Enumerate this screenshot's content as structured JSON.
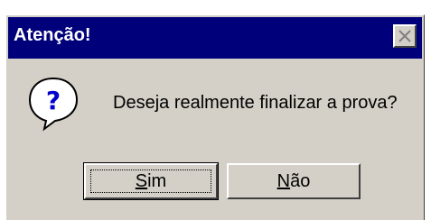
{
  "dialog": {
    "title": "Atenção!",
    "message": "Deseja realmente finalizar a prova?",
    "icon": "question-icon",
    "close_icon": "close-icon"
  },
  "buttons": {
    "yes_mnemonic": "S",
    "yes_rest": "im",
    "no_mnemonic": "N",
    "no_rest": "ão"
  },
  "colors": {
    "titlebar": "#00007b",
    "face": "#d4d0c8"
  }
}
